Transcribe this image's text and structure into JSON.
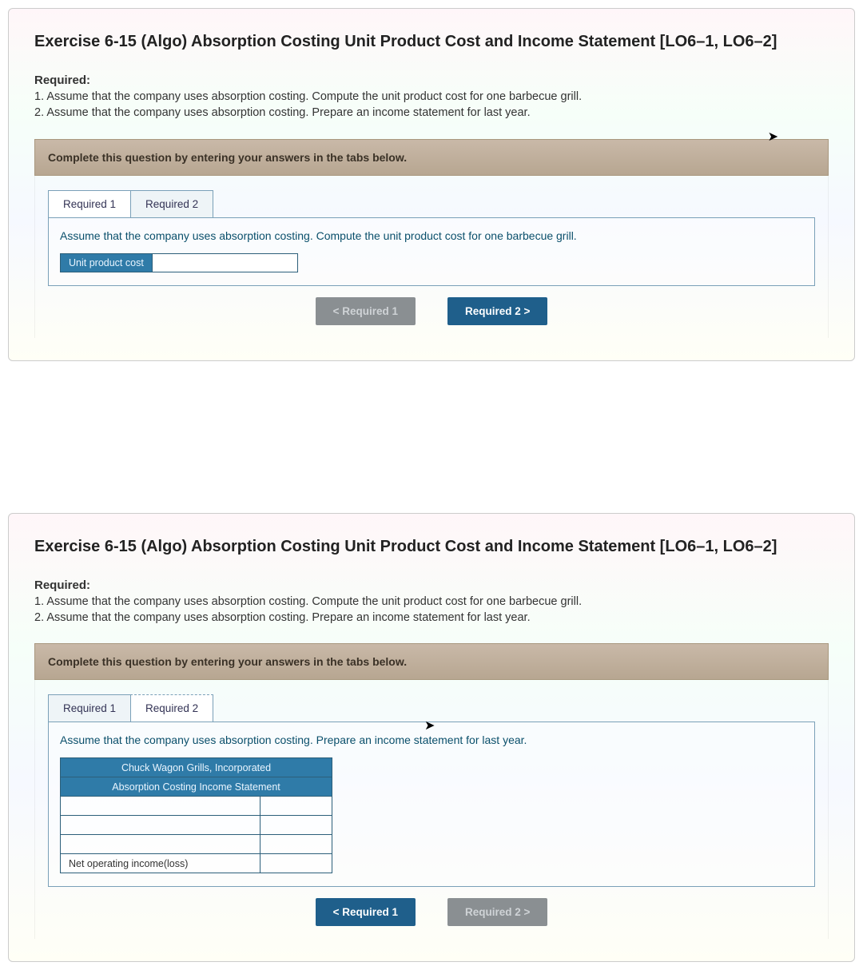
{
  "exercise": {
    "title": "Exercise 6-15 (Algo) Absorption Costing Unit Product Cost and Income Statement [LO6–1, LO6–2]",
    "required_heading": "Required:",
    "req1": "1. Assume that the company uses absorption costing. Compute the unit product cost for one barbecue grill.",
    "req2": "2. Assume that the company uses absorption costing. Prepare an income statement for last year.",
    "instruction": "Complete this question by entering your answers in the tabs below."
  },
  "tabs": {
    "r1": "Required 1",
    "r2": "Required 2"
  },
  "panel1": {
    "desc": "Assume that the company uses absorption costing. Compute the unit product cost for one barbecue grill.",
    "row_label": "Unit product cost",
    "value": ""
  },
  "nav": {
    "prev_disabled": "<  Required 1",
    "next": "Required 2  >",
    "prev": "<  Required 1",
    "next_disabled": "Required 2  >"
  },
  "panel2": {
    "desc": "Assume that the company uses absorption costing. Prepare an income statement for last year.",
    "header1": "Chuck Wagon Grills, Incorporated",
    "header2": "Absorption Costing Income Statement",
    "rows": [
      {
        "label": "",
        "value": ""
      },
      {
        "label": "",
        "value": ""
      },
      {
        "label": "",
        "value": ""
      },
      {
        "label": "Net operating income(loss)",
        "value": ""
      }
    ]
  }
}
